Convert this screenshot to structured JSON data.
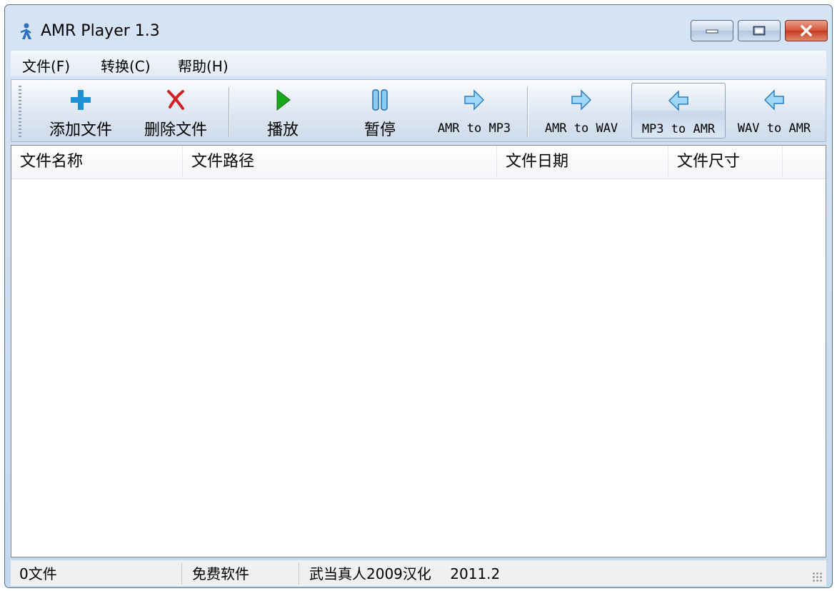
{
  "window": {
    "title": "AMR Player 1.3",
    "app_icon": "person-icon",
    "controls": [
      "minimize-icon",
      "maximize-icon",
      "close-icon"
    ]
  },
  "menubar": {
    "items": [
      {
        "label": "文件(F)"
      },
      {
        "label": "转换(C)"
      },
      {
        "label": "帮助(H)"
      }
    ]
  },
  "toolbar": {
    "buttons": [
      {
        "label": "添加文件",
        "icon": "plus-icon"
      },
      {
        "label": "删除文件",
        "icon": "delete-x-icon"
      },
      {
        "label": "播放",
        "icon": "play-icon"
      },
      {
        "label": "暂停",
        "icon": "pause-icon"
      },
      {
        "label": "AMR to MP3",
        "icon": "arrow-right-icon"
      },
      {
        "label": "AMR to WAV",
        "icon": "arrow-right-icon"
      },
      {
        "label": "MP3 to AMR",
        "icon": "arrow-left-icon"
      },
      {
        "label": "WAV to AMR",
        "icon": "arrow-left-icon"
      }
    ]
  },
  "list": {
    "columns": [
      "文件名称",
      "文件路径",
      "文件日期",
      "文件尺寸"
    ],
    "rows": []
  },
  "statusbar": {
    "file_count": "0文件",
    "license": "免费软件",
    "credit": "武当真人2009汉化",
    "date": "2011.2"
  },
  "colors": {
    "frame": "#c4d8ee",
    "accent_blue": "#1e90d6",
    "play_green": "#19a81a",
    "delete_red": "#d32020",
    "close_red": "#c23a1f"
  }
}
